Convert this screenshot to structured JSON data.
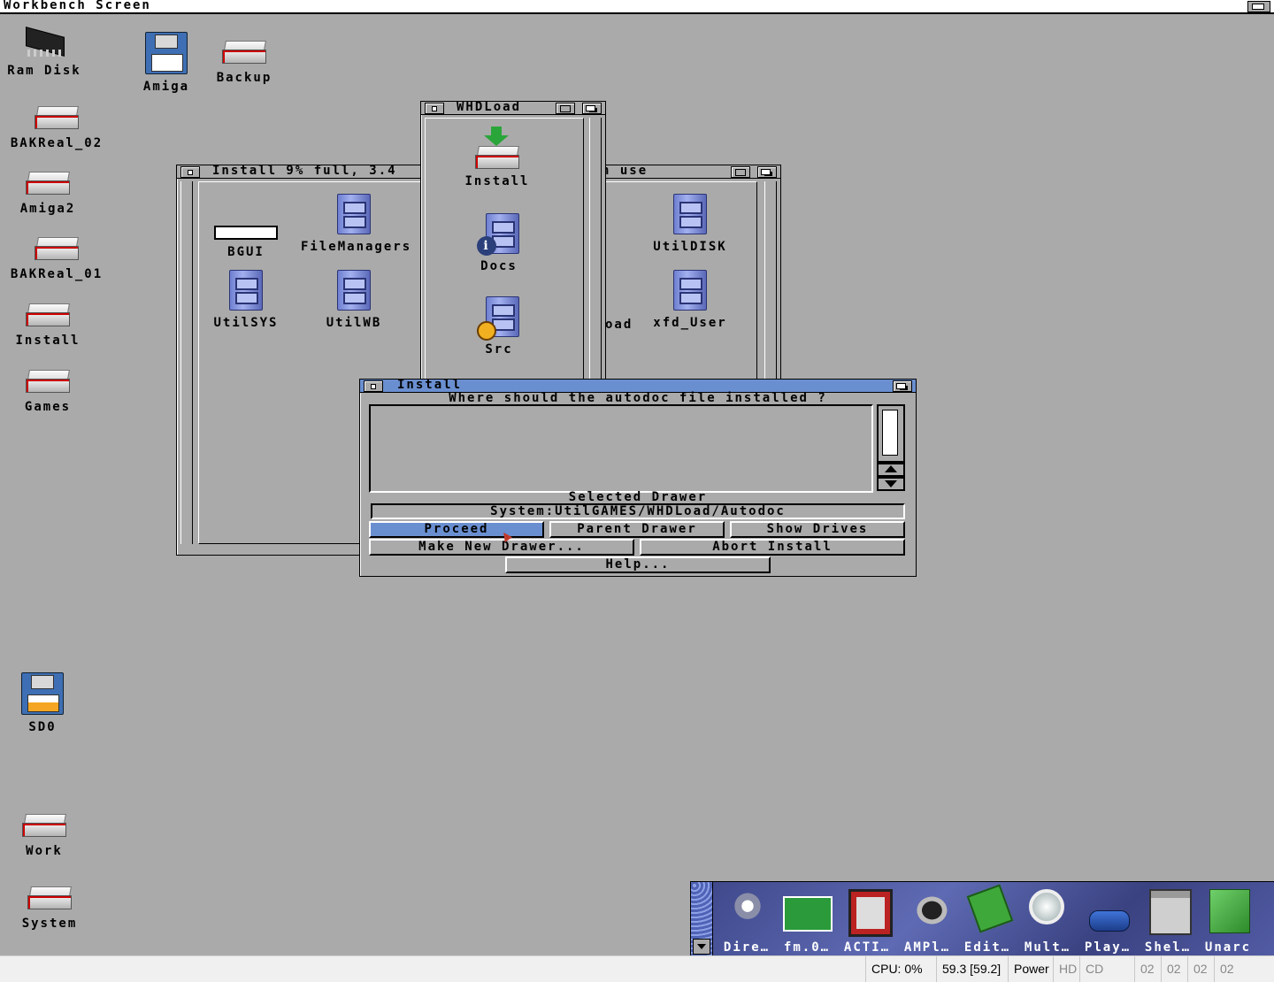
{
  "screen": {
    "title": "Workbench Screen"
  },
  "desktop_icons": {
    "ram_disk": "Ram Disk",
    "amiga": "Amiga",
    "backup": "Backup",
    "bakreal_02": "BAKReal_02",
    "amiga2": "Amiga2",
    "bakreal_01": "BAKReal_01",
    "install": "Install",
    "games": "Games",
    "sd0": "SD0",
    "work": "Work",
    "system": "System"
  },
  "install_window": {
    "title": "Install  9% full, 3.4",
    "title_tail": "n use",
    "items": [
      "BGUI",
      "FileManagers",
      "UtilSYS",
      "UtilWB",
      "UtilDISK",
      "xfd_User"
    ],
    "partial_item": "oad"
  },
  "whdload_window": {
    "title": "WHDLoad",
    "items": [
      "Install",
      "Docs",
      "Src"
    ]
  },
  "requester": {
    "title": "Install",
    "question": "Where should the autodoc file installed ?",
    "selected_label": "Selected Drawer",
    "path": "System:UtilGAMES/WHDLoad/Autodoc",
    "buttons": {
      "proceed": "Proceed",
      "parent": "Parent Drawer",
      "show_drives": "Show Drives",
      "make_new": "Make New Drawer...",
      "abort": "Abort Install",
      "help": "Help..."
    }
  },
  "dock": {
    "items": [
      "Dire…",
      "fm.0…",
      "ACTI…",
      "AMPl…",
      "Edit…",
      "Mult…",
      "Play…",
      "Shel…",
      "Unarc"
    ]
  },
  "status": {
    "cpu": "CPU: 0%",
    "fps": "59.3 [59.2]",
    "power": "Power",
    "hd": "HD",
    "cd": "CD",
    "drives": [
      "02",
      "02",
      "02",
      "02"
    ]
  },
  "colors": {
    "desktop": "#aaaaaa",
    "accent": "#6a8fd0",
    "dock": "#4a5398"
  }
}
